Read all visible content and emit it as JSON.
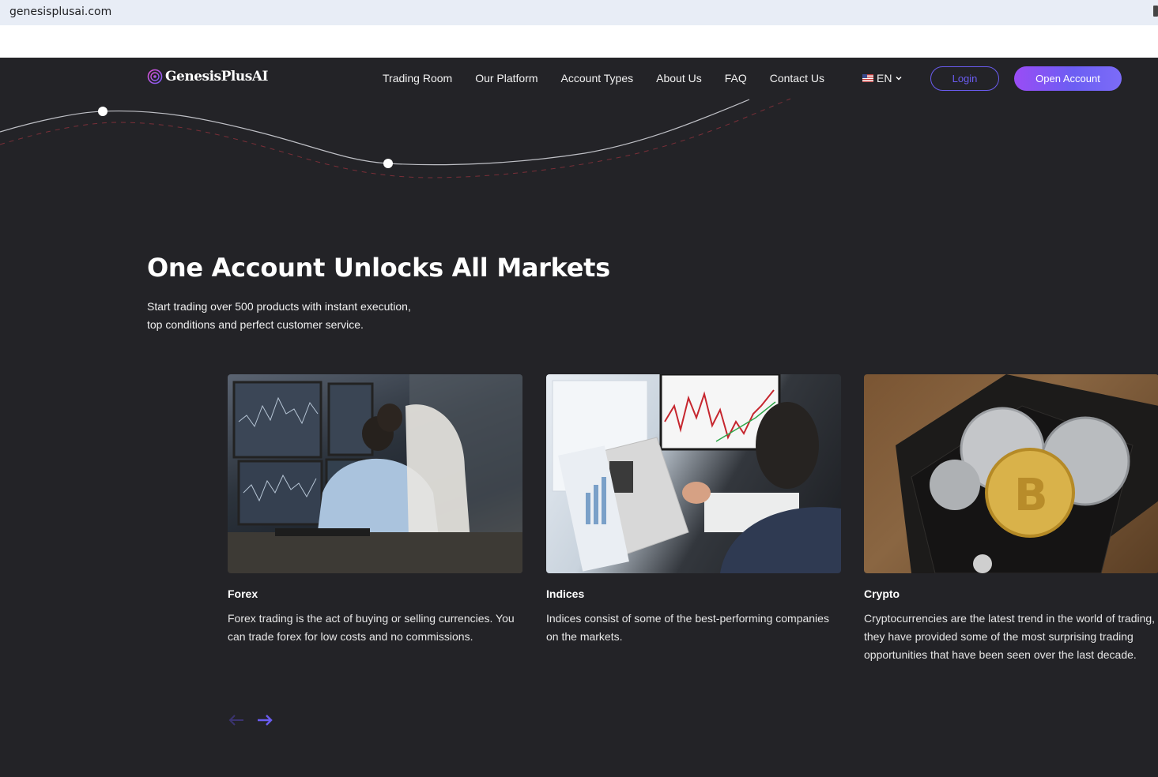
{
  "browser": {
    "url": "genesisplusai.com"
  },
  "header": {
    "logo_text": "GenesisPlusAI",
    "nav": [
      "Trading Room",
      "Our Platform",
      "Account Types",
      "About Us",
      "FAQ",
      "Contact Us"
    ],
    "language": "EN",
    "login_label": "Login",
    "open_account_label": "Open Account"
  },
  "hero": {
    "title": "One Account Unlocks All Markets",
    "subtitle_line1": "Start trading over 500 products with instant execution,",
    "subtitle_line2": "top conditions and perfect customer service."
  },
  "markets": [
    {
      "title": "Forex",
      "description": "Forex trading is the act of buying or selling currencies. You can trade forex for low costs and no commissions."
    },
    {
      "title": "Indices",
      "description": "Indices consist of some of the best-performing companies on the markets."
    },
    {
      "title": "Crypto",
      "description": "Cryptocurrencies are the latest trend in the world of trading, they have provided some of the most surprising trading opportunities that have been seen over the last decade."
    }
  ],
  "colors": {
    "accent": "#6a5cf0",
    "gradient_start": "#9a4cf5",
    "background": "#232327"
  }
}
